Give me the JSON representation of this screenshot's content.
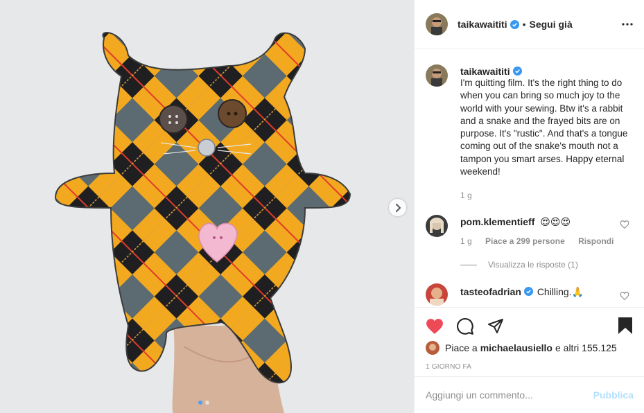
{
  "post": {
    "author": "taikawaititi",
    "follow_status": "Segui già",
    "bullet": "•",
    "caption": "I'm quitting film. It's the right thing to do when you can bring so much joy to the world with your sewing. Btw it's a rabbit and a snake and the frayed bits are on purpose. It's \"rustic\". And that's a tongue coming out of the snake's mouth not a tampon you smart arses. Happy eternal weekend!",
    "caption_age": "1 g"
  },
  "comments": [
    {
      "user": "pom.klementieff",
      "text": "😍😍😍",
      "age": "1 g",
      "likes_label": "Piace a 299 persone",
      "reply_label": "Rispondi",
      "view_replies": "Visualizza le risposte (1)"
    },
    {
      "user": "tasteofadrian",
      "text": "Chilling.🙏"
    }
  ],
  "likes": {
    "prefix": "Piace a",
    "user": "michaelausiello",
    "suffix": "e altri 155.125"
  },
  "timestamp": "1 GIORNO FA",
  "add_comment": {
    "placeholder": "Aggiungi un commento...",
    "publish_label": "Pubblica"
  },
  "carousel": {
    "current": 1,
    "total": 2
  },
  "colors": {
    "like_red": "#ed4956",
    "verified_blue": "#3897f0",
    "publish_disabled": "#b2dffc",
    "secondary_text": "#8e8e8e"
  },
  "icons": [
    "more-options-icon",
    "verified-icon",
    "heart-icon",
    "comment-icon",
    "share-icon",
    "bookmark-icon",
    "next-arrow-icon"
  ]
}
